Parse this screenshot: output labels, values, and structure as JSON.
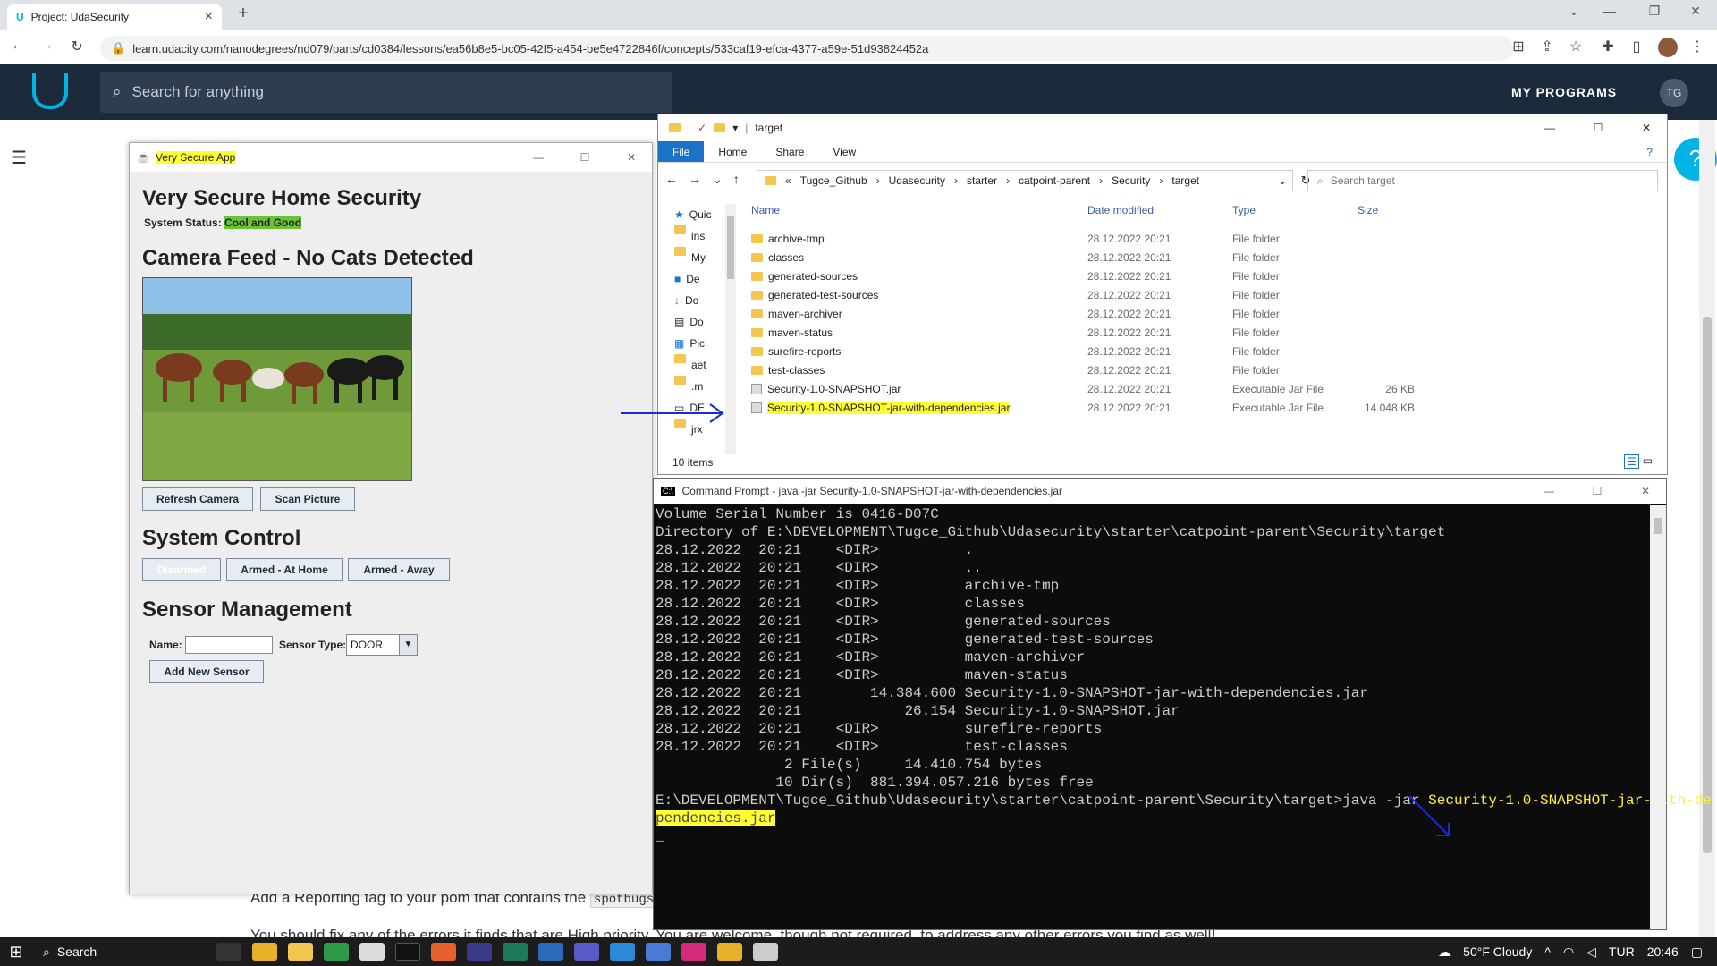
{
  "browser": {
    "tab_title": "Project: UdaSecurity",
    "url": "learn.udacity.com/nanodegrees/nd079/parts/cd0384/lessons/ea56b8e5-bc05-42f5-a454-be5e4722846f/concepts/533caf19-efca-4377-a59e-51d93824452a"
  },
  "udacity": {
    "search_placeholder": "Search for anything",
    "my_programs": "MY PROGRAMS",
    "avatar_initials": "TG",
    "page_text_1": "Add a Reporting tag to your pom that contains the",
    "page_code": "spotbugs",
    "page_text_2": "You should fix any of the errors it finds that are High priority. You are welcome, though not required, to address any other errors you find as well!"
  },
  "java_app": {
    "window_title": "Very Secure App",
    "heading": "Very Secure Home Security",
    "status_label": "System Status:",
    "status_value": "Cool and Good",
    "camera_heading": "Camera Feed - No Cats Detected",
    "refresh_btn": "Refresh Camera",
    "scan_btn": "Scan Picture",
    "system_control_heading": "System Control",
    "disarmed_btn": "Disarmed",
    "armed_home_btn": "Armed - At Home",
    "armed_away_btn": "Armed - Away",
    "sensor_heading": "Sensor Management",
    "name_label": "Name:",
    "sensor_type_label": "Sensor Type:",
    "sensor_type_value": "DOOR",
    "add_sensor_btn": "Add New Sensor",
    "active_color": "#6bc234"
  },
  "explorer": {
    "title": "target",
    "ribbon": [
      "File",
      "Home",
      "Share",
      "View"
    ],
    "breadcrumb": [
      "Tugce_Github",
      "Udasecurity",
      "starter",
      "catpoint-parent",
      "Security",
      "target"
    ],
    "search_placeholder": "Search target",
    "nav": [
      "Quic",
      "ins",
      "My",
      "De",
      "Do",
      "Do",
      "Pic",
      "aet",
      ".m",
      "DE",
      "jrx"
    ],
    "columns": [
      "Name",
      "Date modified",
      "Type",
      "Size"
    ],
    "files": [
      {
        "name": "archive-tmp",
        "date": "28.12.2022 20:21",
        "type": "File folder",
        "size": ""
      },
      {
        "name": "classes",
        "date": "28.12.2022 20:21",
        "type": "File folder",
        "size": ""
      },
      {
        "name": "generated-sources",
        "date": "28.12.2022 20:21",
        "type": "File folder",
        "size": ""
      },
      {
        "name": "generated-test-sources",
        "date": "28.12.2022 20:21",
        "type": "File folder",
        "size": ""
      },
      {
        "name": "maven-archiver",
        "date": "28.12.2022 20:21",
        "type": "File folder",
        "size": ""
      },
      {
        "name": "maven-status",
        "date": "28.12.2022 20:21",
        "type": "File folder",
        "size": ""
      },
      {
        "name": "surefire-reports",
        "date": "28.12.2022 20:21",
        "type": "File folder",
        "size": ""
      },
      {
        "name": "test-classes",
        "date": "28.12.2022 20:21",
        "type": "File folder",
        "size": ""
      },
      {
        "name": "Security-1.0-SNAPSHOT.jar",
        "date": "28.12.2022 20:21",
        "type": "Executable Jar File",
        "size": "26 KB"
      },
      {
        "name": "Security-1.0-SNAPSHOT-jar-with-dependencies.jar",
        "date": "28.12.2022 20:21",
        "type": "Executable Jar File",
        "size": "14.048 KB"
      }
    ],
    "item_count": "10 items"
  },
  "cmd": {
    "title": "Command Prompt - java  -jar Security-1.0-SNAPSHOT-jar-with-dependencies.jar",
    "lines": [
      "Volume Serial Number is 0416-D07C",
      "",
      "Directory of E:\\DEVELOPMENT\\Tugce_Github\\Udasecurity\\starter\\catpoint-parent\\Security\\target",
      "",
      "28.12.2022  20:21    <DIR>          .",
      "28.12.2022  20:21    <DIR>          ..",
      "28.12.2022  20:21    <DIR>          archive-tmp",
      "28.12.2022  20:21    <DIR>          classes",
      "28.12.2022  20:21    <DIR>          generated-sources",
      "28.12.2022  20:21    <DIR>          generated-test-sources",
      "28.12.2022  20:21    <DIR>          maven-archiver",
      "28.12.2022  20:21    <DIR>          maven-status",
      "28.12.2022  20:21        14.384.600 Security-1.0-SNAPSHOT-jar-with-dependencies.jar",
      "28.12.2022  20:21            26.154 Security-1.0-SNAPSHOT.jar",
      "28.12.2022  20:21    <DIR>          surefire-reports",
      "28.12.2022  20:21    <DIR>          test-classes",
      "               2 File(s)     14.410.754 bytes",
      "              10 Dir(s)  881.394.057.216 bytes free",
      ""
    ],
    "prompt": "E:\\DEVELOPMENT\\Tugce_Github\\Udasecurity\\starter\\catpoint-parent\\Security\\target>java -jar ",
    "command_part1": "Security-1.0-SNAPSHOT-jar-with-de",
    "command_part2": "pendencies.jar"
  },
  "taskbar": {
    "search": "Search",
    "weather": "50°F  Cloudy",
    "lang": "TUR",
    "time": "20:46"
  }
}
